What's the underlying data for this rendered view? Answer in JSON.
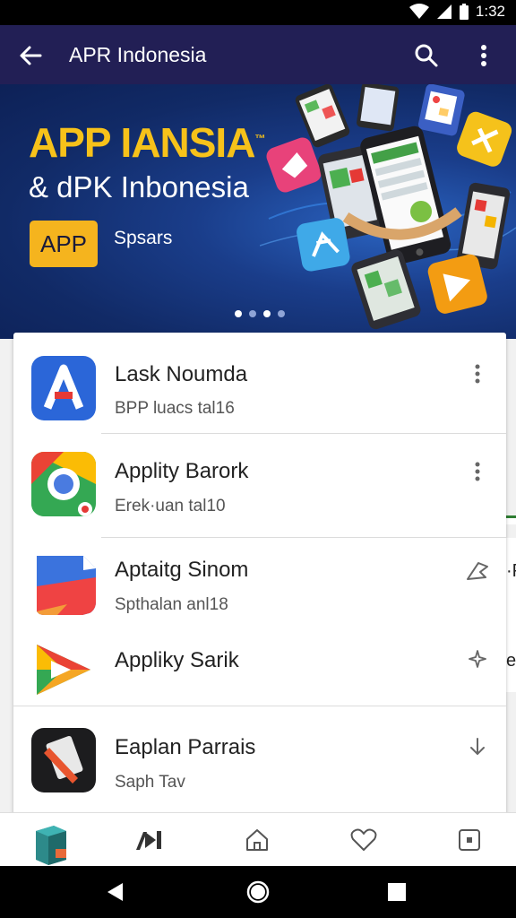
{
  "status_bar": {
    "time": "1:32",
    "icons": [
      "wifi-icon",
      "signal-icon",
      "battery-icon"
    ]
  },
  "app_bar": {
    "title": "APR Indonesia",
    "icons": [
      "back-arrow-icon",
      "search-icon",
      "more-vert-icon"
    ]
  },
  "banner": {
    "title_line1": "APP IANSIA",
    "title_mark": "™",
    "title_line2": "& dPK Inbonesia",
    "chip_label": "APP",
    "chip_caption": "Spsars",
    "carousel_dots": 4,
    "active_dot": 2
  },
  "apps": [
    {
      "name": "Lask Noumda",
      "subtitle": "BPP luacs tal16",
      "action_icon": "more-vert-icon"
    },
    {
      "name": "Applity Barork",
      "subtitle": "Erek·uan tal10",
      "action_icon": "more-vert-icon"
    },
    {
      "name": "Aptaitg Sinom",
      "subtitle": "Spthalan anl18",
      "action_icon": "share-arrow-icon"
    },
    {
      "name": "Appliky Sarik",
      "subtitle": "",
      "action_icon": "sparkle-icon"
    },
    {
      "name": "Eaplan Parrais",
      "subtitle": "Saph Tav",
      "action_icon": "download-icon"
    }
  ],
  "edge_peek": {
    "text1": "·P",
    "text2": "el"
  },
  "bottom_nav": {
    "items": [
      "apps-icon",
      "media-icon",
      "home-icon",
      "heart-icon",
      "square-icon"
    ]
  },
  "system_nav": {
    "items": [
      "back-triangle-icon",
      "home-circle-icon",
      "recents-square-icon"
    ]
  },
  "colors": {
    "app_bar": "#221f55",
    "banner_bg": "#112a66",
    "accent_yellow": "#f7c21a",
    "card_bg": "#ffffff"
  }
}
